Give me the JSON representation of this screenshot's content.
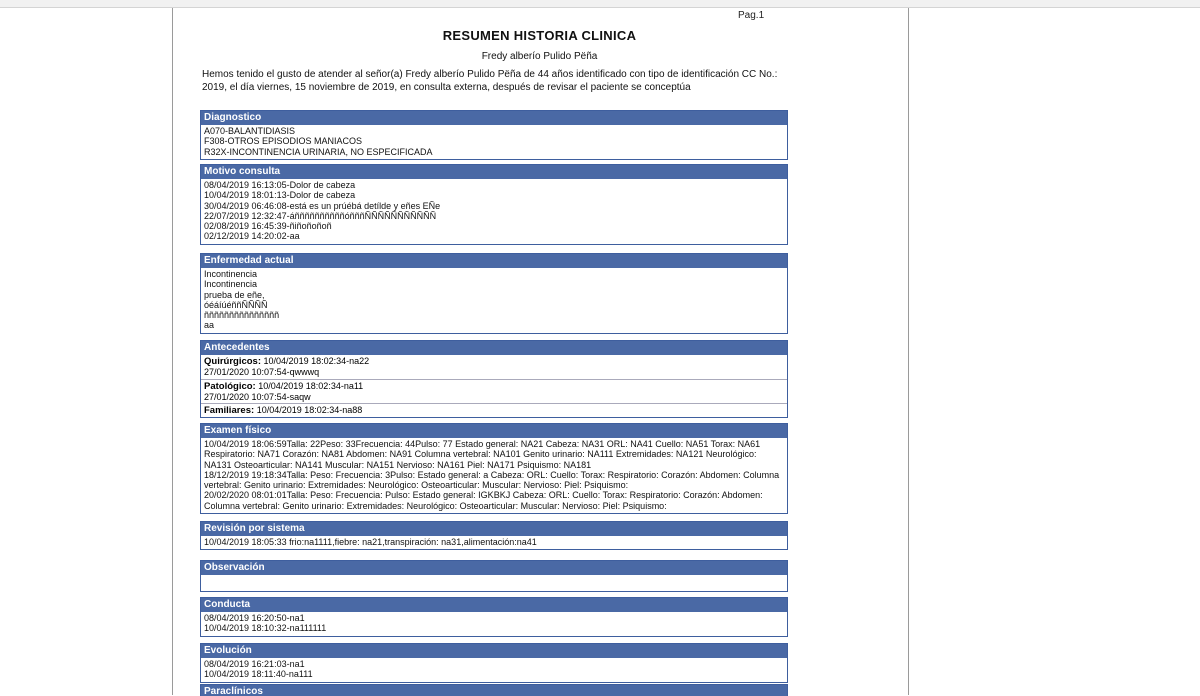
{
  "header": {
    "page_label": "Pag.1",
    "title": "RESUMEN HISTORIA CLINICA",
    "patient_name": "Fredy alberío Pulido  Pëña",
    "intro": "Hemos tenido el gusto de atender al señor(a) Fredy alberío Pulido  Pëña de 44 años identificado con tipo de identificación CC No.: 2019,  el día viernes, 15 noviembre de 2019, en consulta externa, después de revisar el paciente se conceptúa"
  },
  "diagnostico": {
    "title": "Diagnostico",
    "lines": [
      "A070-BALANTIDIASIS",
      "F308-OTROS EPISODIOS MANIACOS",
      "R32X-INCONTINENCIA URINARIA, NO ESPECIFICADA"
    ]
  },
  "motivo": {
    "title": "Motivo consulta",
    "lines": [
      "08/04/2019 16:13:05-Dolor de cabeza",
      "10/04/2019 18:01:13-Dolor de cabeza",
      "30/04/2019 06:46:08-está es un prúébá detílde y eñes EÑe",
      "22/07/2019 12:32:47-áññññññññññóñññÑÑÑÑÑÑÑÑÑÑÑ",
      "02/08/2019 16:45:39-ñiñoñoñoñ",
      "02/12/2019 14:20:02-aa"
    ]
  },
  "enfermedad": {
    "title": "Enfermedad actual",
    "lines": [
      "Incontinencia",
      "Incontinencia",
      "prueba de eñe,",
      "óéáíúéññÑÑÑÑ",
      "ñññññññññññññññ",
      "aa"
    ]
  },
  "antecedentes": {
    "title": "Antecedentes",
    "quirurgicos": {
      "label": "Quirúrgicos:",
      "lines": [
        "10/04/2019 18:02:34-na22",
        "27/01/2020 10:07:54-qwwwq"
      ]
    },
    "patologico": {
      "label": "Patológico:",
      "lines": [
        "10/04/2019 18:02:34-na11",
        "27/01/2020 10:07:54-saqw"
      ]
    },
    "familiares": {
      "label": "Familiares:",
      "lines": [
        "10/04/2019 18:02:34-na88"
      ]
    }
  },
  "examen": {
    "title": "Examen físico",
    "p1": "10/04/2019 18:06:59Talla: 22Peso: 33Frecuencia: 44Pulso: 77 Estado general: NA21 Cabeza: NA31 ORL: NA41 Cuello: NA51 Torax: NA61 Respiratorio: NA71 Corazón: NA81 Abdomen: NA91 Columna vertebral: NA101 Genito urinario: NA111 Extremidades: NA121 Neurológico: NA131 Osteoarticular: NA141 Muscular: NA151 Nervioso: NA161 Piel: NA171 Psiquismo: NA181",
    "p2": "18/12/2019 19:18:34Talla: Peso: Frecuencia: 3Pulso:  Estado general: a Cabeza:  ORL:  Cuello:  Torax:  Respiratorio:  Corazón:  Abdomen:  Columna vertebral:  Genito urinario:  Extremidades:  Neurológico:  Osteoarticular:  Muscular:  Nervioso:  Piel:  Psiquismo:",
    "p3": "20/02/2020 08:01:01Talla: Peso: Frecuencia: Pulso:  Estado general: IGKBKJ Cabeza:  ORL:  Cuello:  Torax:  Respiratorio:  Corazón:  Abdomen:  Columna vertebral:  Genito urinario:  Extremidades:  Neurológico:  Osteoarticular:  Muscular:  Nervioso:  Piel:  Psiquismo:"
  },
  "revision": {
    "title": "Revisión por sistema",
    "lines": [
      "10/04/2019 18:05:33 frio:na1111,fiebre: na21,transpiración: na31,alimentación:na41"
    ]
  },
  "observacion": {
    "title": "Observación"
  },
  "conducta": {
    "title": "Conducta",
    "lines": [
      "08/04/2019 16:20:50-na1",
      "10/04/2019 18:10:32-na111111"
    ]
  },
  "evolucion": {
    "title": "Evolución",
    "lines": [
      "08/04/2019 16:21:03-na1",
      "10/04/2019 18:11:40-na111"
    ]
  },
  "paraclinicos": {
    "title": "Paraclínicos"
  }
}
